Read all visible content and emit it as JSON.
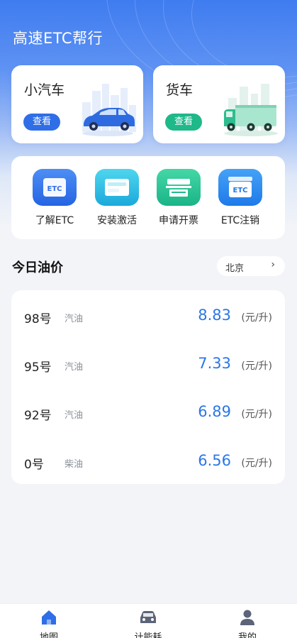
{
  "app": {
    "title": "高速ETC帮行"
  },
  "vehicles": [
    {
      "title": "小汽车",
      "button": "查看"
    },
    {
      "title": "货车",
      "button": "查看"
    }
  ],
  "services": [
    {
      "label": "了解ETC",
      "icon": "etc-card-icon"
    },
    {
      "label": "安装激活",
      "icon": "device-install-icon"
    },
    {
      "label": "申请开票",
      "icon": "printer-icon"
    },
    {
      "label": "ETC注销",
      "icon": "etc-cancel-icon"
    }
  ],
  "oil": {
    "title": "今日油价",
    "city": "北京",
    "rows": [
      {
        "grade": "98号",
        "kind": "汽油",
        "price": "8.83",
        "unit": "(元/升)"
      },
      {
        "grade": "95号",
        "kind": "汽油",
        "price": "7.33",
        "unit": "(元/升)"
      },
      {
        "grade": "92号",
        "kind": "汽油",
        "price": "6.89",
        "unit": "(元/升)"
      },
      {
        "grade": "0号",
        "kind": "柴油",
        "price": "6.56",
        "unit": "(元/升)"
      }
    ]
  },
  "tabs": [
    {
      "label": "地图",
      "icon": "home-icon"
    },
    {
      "label": "计能耗",
      "icon": "car-icon"
    },
    {
      "label": "我的",
      "icon": "user-icon"
    }
  ],
  "colors": {
    "primary": "#2f6ee6",
    "truck_accent": "#1fb889",
    "price": "#2a77e8"
  }
}
